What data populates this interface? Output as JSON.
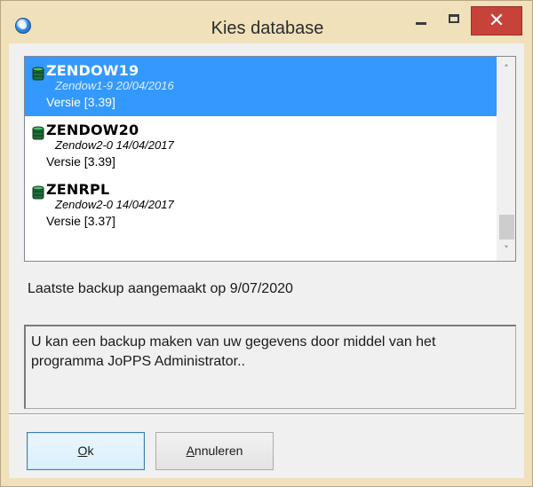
{
  "window": {
    "title": "Kies database",
    "close_glyph": "✕"
  },
  "databases": [
    {
      "name": "ZENDOW19",
      "description": "Zendow1-9 20/04/2016",
      "version": "Versie [3.39]",
      "selected": true,
      "icon": "database-icon"
    },
    {
      "name": "ZENDOW20",
      "description": "Zendow2-0 14/04/2017",
      "version": "Versie [3.39]",
      "selected": false,
      "icon": "database-icon"
    },
    {
      "name": "ZENRPL",
      "description": "Zendow2-0 14/04/2017",
      "version": "Versie [3.37]",
      "selected": false,
      "icon": "database-icon"
    }
  ],
  "scroll": {
    "up_glyph": "˄",
    "down_glyph": "˅"
  },
  "status": {
    "last_backup": "Laatste backup aangemaakt op 9/07/2020"
  },
  "info": {
    "message": "U kan een backup maken van uw gegevens door middel van het programma JoPPS Administrator.."
  },
  "buttons": {
    "ok": {
      "accel": "O",
      "rest": "k"
    },
    "cancel": {
      "accel": "A",
      "rest": "nnuleren"
    }
  },
  "colors": {
    "title_bar": "#f0e1bb",
    "selection": "#3399ff",
    "close_button": "#c7433a",
    "dialog_bg": "#f0f0f0"
  }
}
